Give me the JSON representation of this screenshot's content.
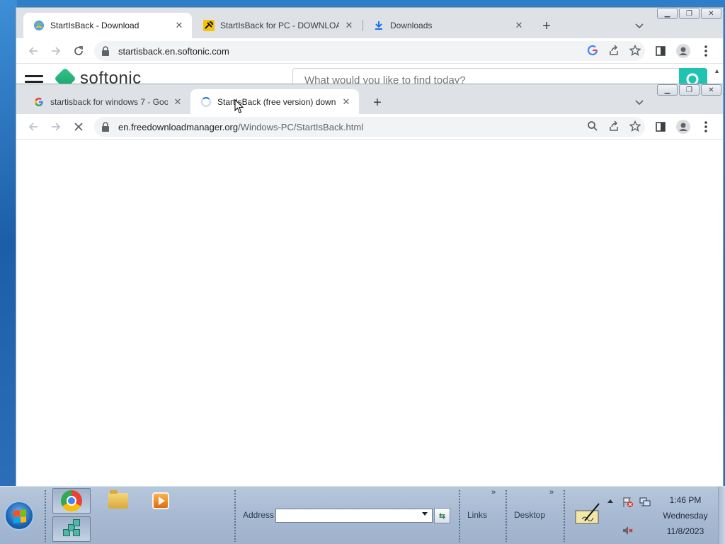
{
  "back_window": {
    "tabs": [
      {
        "title": "StartIsBack - Download",
        "icon": "softonic-globe-icon",
        "active": true
      },
      {
        "title": "StartIsBack for PC - DOWNLOAD",
        "icon": "satellite-icon",
        "active": false
      },
      {
        "title": "Downloads",
        "icon": "download-icon",
        "active": false
      }
    ],
    "url": "startisback.en.softonic.com",
    "site": {
      "brand": "softonic",
      "search_placeholder": "What would you like to find today?"
    }
  },
  "front_window": {
    "tabs": [
      {
        "title": "startisback for windows 7 - Goog",
        "icon": "google-icon",
        "active": false
      },
      {
        "title": "StartIsBack (free version) downlo",
        "icon": "loading-spinner-icon",
        "active": true
      }
    ],
    "url_host": "en.freedownloadmanager.org",
    "url_path": "/Windows-PC/StartIsBack.html"
  },
  "taskbar": {
    "address_label": "Address",
    "links_label": "Links",
    "desktop_label": "Desktop",
    "chevron": "»",
    "clock": {
      "time": "1:46 PM",
      "day": "Wednesday",
      "date": "11/8/2023"
    }
  },
  "colors": {
    "tabstrip": "#dee1e6",
    "omnibox": "#f1f3f4",
    "taskbar": "#a9bbd3",
    "accent_blue": "#1a73e8",
    "softonic_green": "#20c3b1"
  }
}
